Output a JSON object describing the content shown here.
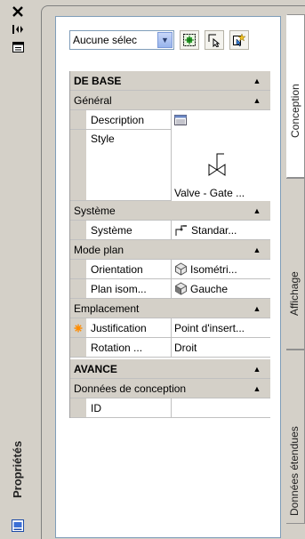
{
  "palette": {
    "title": "Propriétés",
    "close_icon": "close-icon",
    "autohide_icon": "autohide-icon",
    "properties_menu_icon": "properties-menu-icon"
  },
  "toolbar": {
    "selection_value": "Aucune sélec",
    "quick_select_icon": "quick-select-icon",
    "select_objects_icon": "select-objects-icon",
    "toggle_pickadd_icon": "toggle-pickadd-icon"
  },
  "tabs": [
    {
      "label": "Conception",
      "active": true
    },
    {
      "label": "Affichage",
      "active": false
    },
    {
      "label": "Données étendues",
      "active": false
    }
  ],
  "grid": {
    "base_section": "DE BASE",
    "general_group": "Général",
    "description_label": "Description",
    "style_label": "Style",
    "style_value": "Valve - Gate ...",
    "system_group": "Système",
    "system_label": "Système",
    "system_value": "Standar...",
    "plan_mode_group": "Mode plan",
    "orientation_label": "Orientation",
    "orientation_value": "Isométri...",
    "iso_plane_label": "Plan isom...",
    "iso_plane_value": "Gauche",
    "placement_group": "Emplacement",
    "justification_label": "Justification",
    "justification_value": "Point d'insert...",
    "rotation_label": "Rotation ...",
    "rotation_value": "Droit",
    "advanced_section": "AVANCE",
    "design_data_group": "Données de conception",
    "id_label": "ID",
    "id_value": ""
  },
  "colors": {
    "panel_bg": "#d4d0c8",
    "grid_bg": "#ffffff",
    "accent_star": "#ff8c00"
  }
}
